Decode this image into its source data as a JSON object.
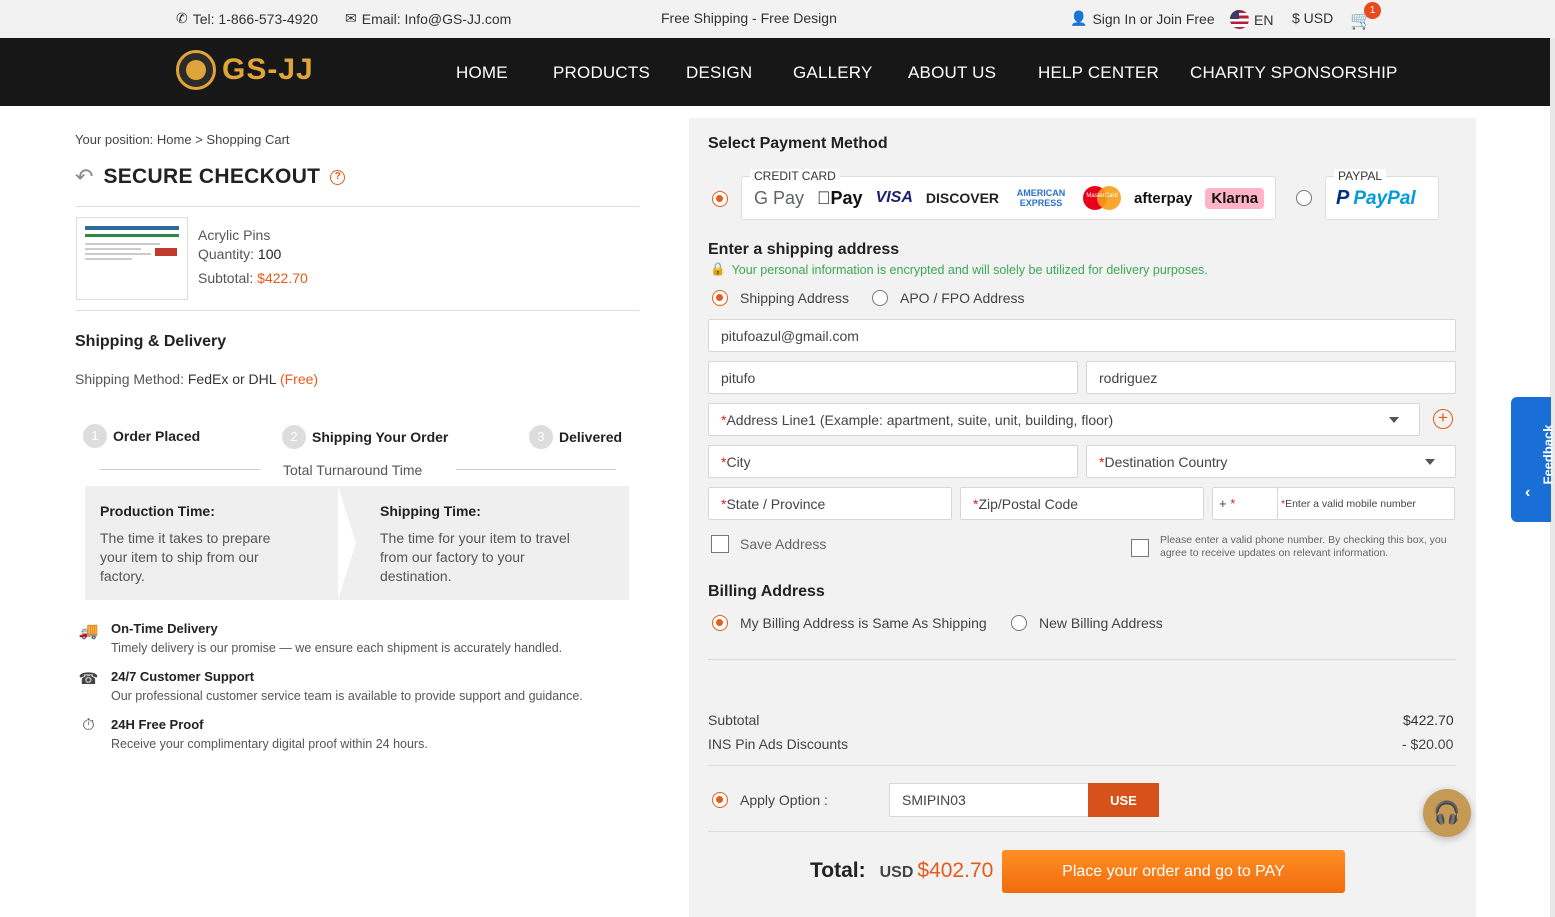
{
  "topbar": {
    "tel": "Tel: 1-866-573-4920",
    "email": "Email: Info@GS-JJ.com",
    "promo": "Free Shipping - Free Design",
    "signin": "Sign In or Join Free",
    "lang": "EN",
    "currency": "$ USD",
    "cart_count": "1"
  },
  "nav": {
    "logo": "GS-JJ",
    "items": [
      "HOME",
      "PRODUCTS",
      "DESIGN",
      "GALLERY",
      "ABOUT US",
      "HELP CENTER",
      "CHARITY SPONSORSHIP"
    ]
  },
  "left": {
    "breadcrumb": "Your position: Home > Shopping Cart",
    "title": "SECURE CHECKOUT",
    "product": {
      "name": "Acrylic Pins",
      "qty_label": "Quantity:",
      "qty": "100",
      "subtotal_label": "Subtotal:",
      "subtotal": "$422.70"
    },
    "shipping_title": "Shipping & Delivery",
    "ship_method_label": "Shipping Method:",
    "ship_method": "FedEx or DHL",
    "ship_free": "(Free)",
    "steps": [
      {
        "num": "1",
        "label": "Order Placed"
      },
      {
        "num": "2",
        "label": "Shipping Your Order"
      },
      {
        "num": "3",
        "label": "Delivered"
      }
    ],
    "turnaround": "Total Turnaround Time",
    "production_title": "Production Time:",
    "production_text": "The time it takes to prepare your item to ship from our factory.",
    "shipping_time_title": "Shipping Time:",
    "shipping_time_text": "The time for your item to travel from our factory to your destination.",
    "features": [
      {
        "title": "On-Time Delivery",
        "desc": "Timely delivery is our promise — we ensure each shipment is accurately handled."
      },
      {
        "title": "24/7 Customer Support",
        "desc": "Our professional customer service team is available to provide support and guidance."
      },
      {
        "title": "24H Free Proof",
        "desc": "Receive your complimentary digital proof within 24 hours."
      }
    ]
  },
  "payment": {
    "title": "Select Payment Method",
    "credit_label": "CREDIT CARD",
    "logos": [
      "G Pay",
      "Pay",
      "VISA",
      "DISCOVER",
      "AMERICAN EXPRESS",
      "MasterCard",
      "afterpay",
      "Klarna"
    ],
    "paypal_label": "PAYPAL",
    "paypal_logo": "PayPal"
  },
  "shipping": {
    "title": "Enter a shipping address",
    "secure_note": "Your personal information is encrypted and will solely be utilized for delivery purposes.",
    "opt_shipping": "Shipping Address",
    "opt_apo": "APO / FPO Address",
    "email": "pitufoazul@gmail.com",
    "first_name": "pitufo",
    "last_name": "rodriguez",
    "address_ph": "Address Line1 (Example: apartment, suite, unit, building, floor)",
    "city_ph": "City",
    "country_ph": "Destination Country",
    "state_ph": "State / Province",
    "zip_ph": "Zip/Postal Code",
    "phone_prefix": "+",
    "phone_ph": "Enter a valid mobile number",
    "save_address": "Save Address",
    "phone_consent": "Please enter a valid phone number. By checking this box, you agree to receive updates on relevant information."
  },
  "billing": {
    "title": "Billing Address",
    "opt_same": "My Billing Address is Same As Shipping",
    "opt_new": "New Billing Address"
  },
  "summary": {
    "subtotal_label": "Subtotal",
    "subtotal": "$422.70",
    "discount_label": "INS Pin Ads Discounts",
    "discount": "- $20.00",
    "apply_label": "Apply Option :",
    "code": "SMIPIN03",
    "use": "USE",
    "total_label": "Total:",
    "total_currency": "USD",
    "total": "$402.70",
    "pay_button": "Place your order and go to PAY"
  },
  "widgets": {
    "feedback": "Feedback"
  },
  "colors": {
    "accent": "#e55b1b",
    "nav_bg": "#171717",
    "logo_gold": "#e0a43a",
    "feedback_blue": "#1a6fd6"
  }
}
